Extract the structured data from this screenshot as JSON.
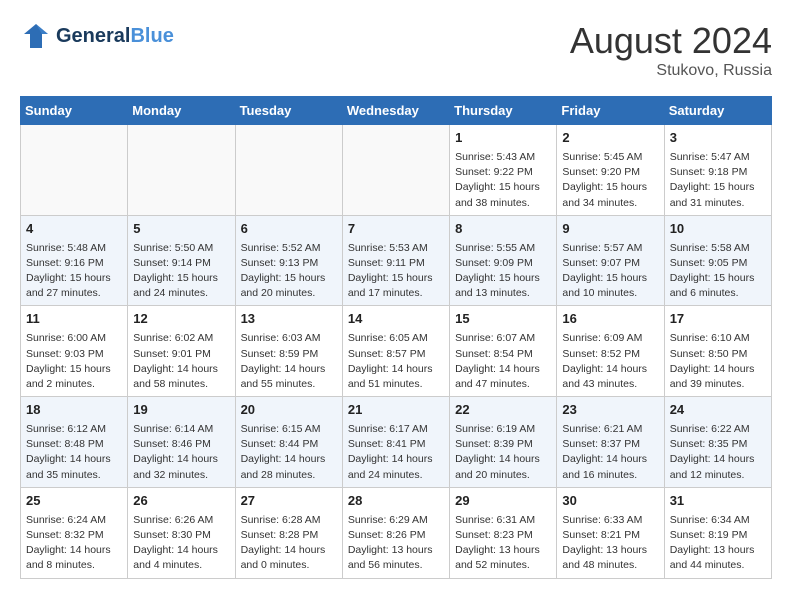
{
  "header": {
    "logo_line1": "General",
    "logo_line2": "Blue",
    "month": "August 2024",
    "location": "Stukovo, Russia"
  },
  "days_of_week": [
    "Sunday",
    "Monday",
    "Tuesday",
    "Wednesday",
    "Thursday",
    "Friday",
    "Saturday"
  ],
  "weeks": [
    [
      {
        "day": "",
        "content": ""
      },
      {
        "day": "",
        "content": ""
      },
      {
        "day": "",
        "content": ""
      },
      {
        "day": "",
        "content": ""
      },
      {
        "day": "1",
        "content": "Sunrise: 5:43 AM\nSunset: 9:22 PM\nDaylight: 15 hours\nand 38 minutes."
      },
      {
        "day": "2",
        "content": "Sunrise: 5:45 AM\nSunset: 9:20 PM\nDaylight: 15 hours\nand 34 minutes."
      },
      {
        "day": "3",
        "content": "Sunrise: 5:47 AM\nSunset: 9:18 PM\nDaylight: 15 hours\nand 31 minutes."
      }
    ],
    [
      {
        "day": "4",
        "content": "Sunrise: 5:48 AM\nSunset: 9:16 PM\nDaylight: 15 hours\nand 27 minutes."
      },
      {
        "day": "5",
        "content": "Sunrise: 5:50 AM\nSunset: 9:14 PM\nDaylight: 15 hours\nand 24 minutes."
      },
      {
        "day": "6",
        "content": "Sunrise: 5:52 AM\nSunset: 9:13 PM\nDaylight: 15 hours\nand 20 minutes."
      },
      {
        "day": "7",
        "content": "Sunrise: 5:53 AM\nSunset: 9:11 PM\nDaylight: 15 hours\nand 17 minutes."
      },
      {
        "day": "8",
        "content": "Sunrise: 5:55 AM\nSunset: 9:09 PM\nDaylight: 15 hours\nand 13 minutes."
      },
      {
        "day": "9",
        "content": "Sunrise: 5:57 AM\nSunset: 9:07 PM\nDaylight: 15 hours\nand 10 minutes."
      },
      {
        "day": "10",
        "content": "Sunrise: 5:58 AM\nSunset: 9:05 PM\nDaylight: 15 hours\nand 6 minutes."
      }
    ],
    [
      {
        "day": "11",
        "content": "Sunrise: 6:00 AM\nSunset: 9:03 PM\nDaylight: 15 hours\nand 2 minutes."
      },
      {
        "day": "12",
        "content": "Sunrise: 6:02 AM\nSunset: 9:01 PM\nDaylight: 14 hours\nand 58 minutes."
      },
      {
        "day": "13",
        "content": "Sunrise: 6:03 AM\nSunset: 8:59 PM\nDaylight: 14 hours\nand 55 minutes."
      },
      {
        "day": "14",
        "content": "Sunrise: 6:05 AM\nSunset: 8:57 PM\nDaylight: 14 hours\nand 51 minutes."
      },
      {
        "day": "15",
        "content": "Sunrise: 6:07 AM\nSunset: 8:54 PM\nDaylight: 14 hours\nand 47 minutes."
      },
      {
        "day": "16",
        "content": "Sunrise: 6:09 AM\nSunset: 8:52 PM\nDaylight: 14 hours\nand 43 minutes."
      },
      {
        "day": "17",
        "content": "Sunrise: 6:10 AM\nSunset: 8:50 PM\nDaylight: 14 hours\nand 39 minutes."
      }
    ],
    [
      {
        "day": "18",
        "content": "Sunrise: 6:12 AM\nSunset: 8:48 PM\nDaylight: 14 hours\nand 35 minutes."
      },
      {
        "day": "19",
        "content": "Sunrise: 6:14 AM\nSunset: 8:46 PM\nDaylight: 14 hours\nand 32 minutes."
      },
      {
        "day": "20",
        "content": "Sunrise: 6:15 AM\nSunset: 8:44 PM\nDaylight: 14 hours\nand 28 minutes."
      },
      {
        "day": "21",
        "content": "Sunrise: 6:17 AM\nSunset: 8:41 PM\nDaylight: 14 hours\nand 24 minutes."
      },
      {
        "day": "22",
        "content": "Sunrise: 6:19 AM\nSunset: 8:39 PM\nDaylight: 14 hours\nand 20 minutes."
      },
      {
        "day": "23",
        "content": "Sunrise: 6:21 AM\nSunset: 8:37 PM\nDaylight: 14 hours\nand 16 minutes."
      },
      {
        "day": "24",
        "content": "Sunrise: 6:22 AM\nSunset: 8:35 PM\nDaylight: 14 hours\nand 12 minutes."
      }
    ],
    [
      {
        "day": "25",
        "content": "Sunrise: 6:24 AM\nSunset: 8:32 PM\nDaylight: 14 hours\nand 8 minutes."
      },
      {
        "day": "26",
        "content": "Sunrise: 6:26 AM\nSunset: 8:30 PM\nDaylight: 14 hours\nand 4 minutes."
      },
      {
        "day": "27",
        "content": "Sunrise: 6:28 AM\nSunset: 8:28 PM\nDaylight: 14 hours\nand 0 minutes."
      },
      {
        "day": "28",
        "content": "Sunrise: 6:29 AM\nSunset: 8:26 PM\nDaylight: 13 hours\nand 56 minutes."
      },
      {
        "day": "29",
        "content": "Sunrise: 6:31 AM\nSunset: 8:23 PM\nDaylight: 13 hours\nand 52 minutes."
      },
      {
        "day": "30",
        "content": "Sunrise: 6:33 AM\nSunset: 8:21 PM\nDaylight: 13 hours\nand 48 minutes."
      },
      {
        "day": "31",
        "content": "Sunrise: 6:34 AM\nSunset: 8:19 PM\nDaylight: 13 hours\nand 44 minutes."
      }
    ]
  ]
}
